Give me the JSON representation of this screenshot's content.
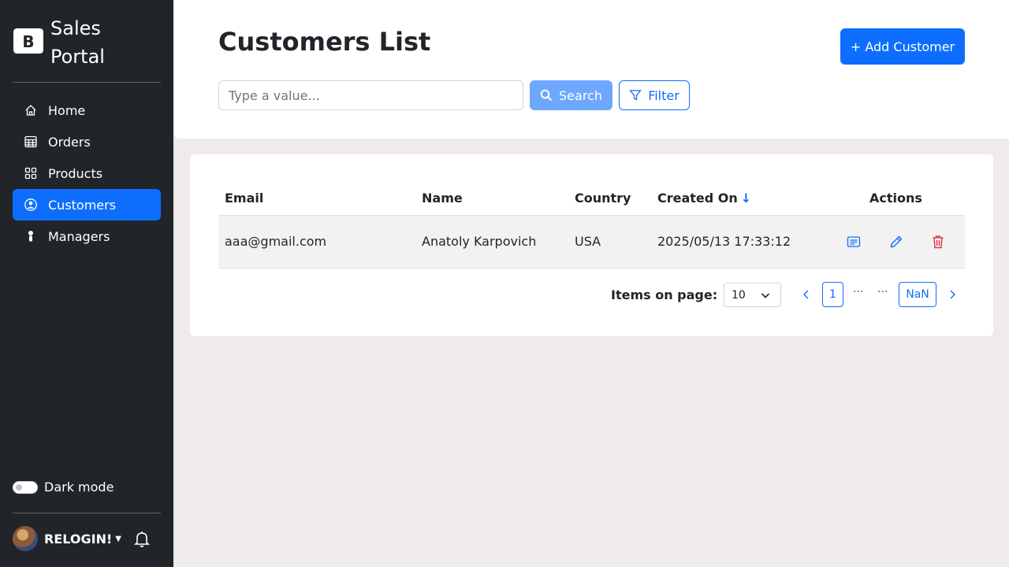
{
  "app": {
    "brand_line1": "Sales",
    "brand_line2": "Portal",
    "logo_letter": "B"
  },
  "sidebar": {
    "items": [
      {
        "label": "Home",
        "icon": "house-icon",
        "active": false
      },
      {
        "label": "Orders",
        "icon": "table-icon",
        "active": false
      },
      {
        "label": "Products",
        "icon": "grid-icon",
        "active": false
      },
      {
        "label": "Customers",
        "icon": "person-circle-icon",
        "active": true
      },
      {
        "label": "Managers",
        "icon": "person-standing-icon",
        "active": false
      }
    ],
    "dark_mode_label": "Dark mode",
    "dark_mode_on": false,
    "user_name": "RELOGIN!"
  },
  "header": {
    "title": "Customers List",
    "add_button_label": "+ Add Customer",
    "search_placeholder": "Type a value...",
    "search_value": "",
    "search_button_label": "Search",
    "filter_button_label": "Filter"
  },
  "table": {
    "columns": [
      "Email",
      "Name",
      "Country",
      "Created On",
      "Actions"
    ],
    "sort_arrow": "↓",
    "rows": [
      {
        "email": "aaa@gmail.com",
        "name": "Anatoly Karpovich",
        "country": "USA",
        "created_on": "2025/05/13 17:33:12"
      }
    ]
  },
  "pagination": {
    "items_label": "Items on page:",
    "page_size": "10",
    "current_page": "1",
    "ellipsis": "···",
    "last_page": "NaN"
  },
  "colors": {
    "primary": "#0d6efd",
    "sidebar_bg": "#212529",
    "danger": "#dc3545",
    "page_bg": "#efebea"
  }
}
